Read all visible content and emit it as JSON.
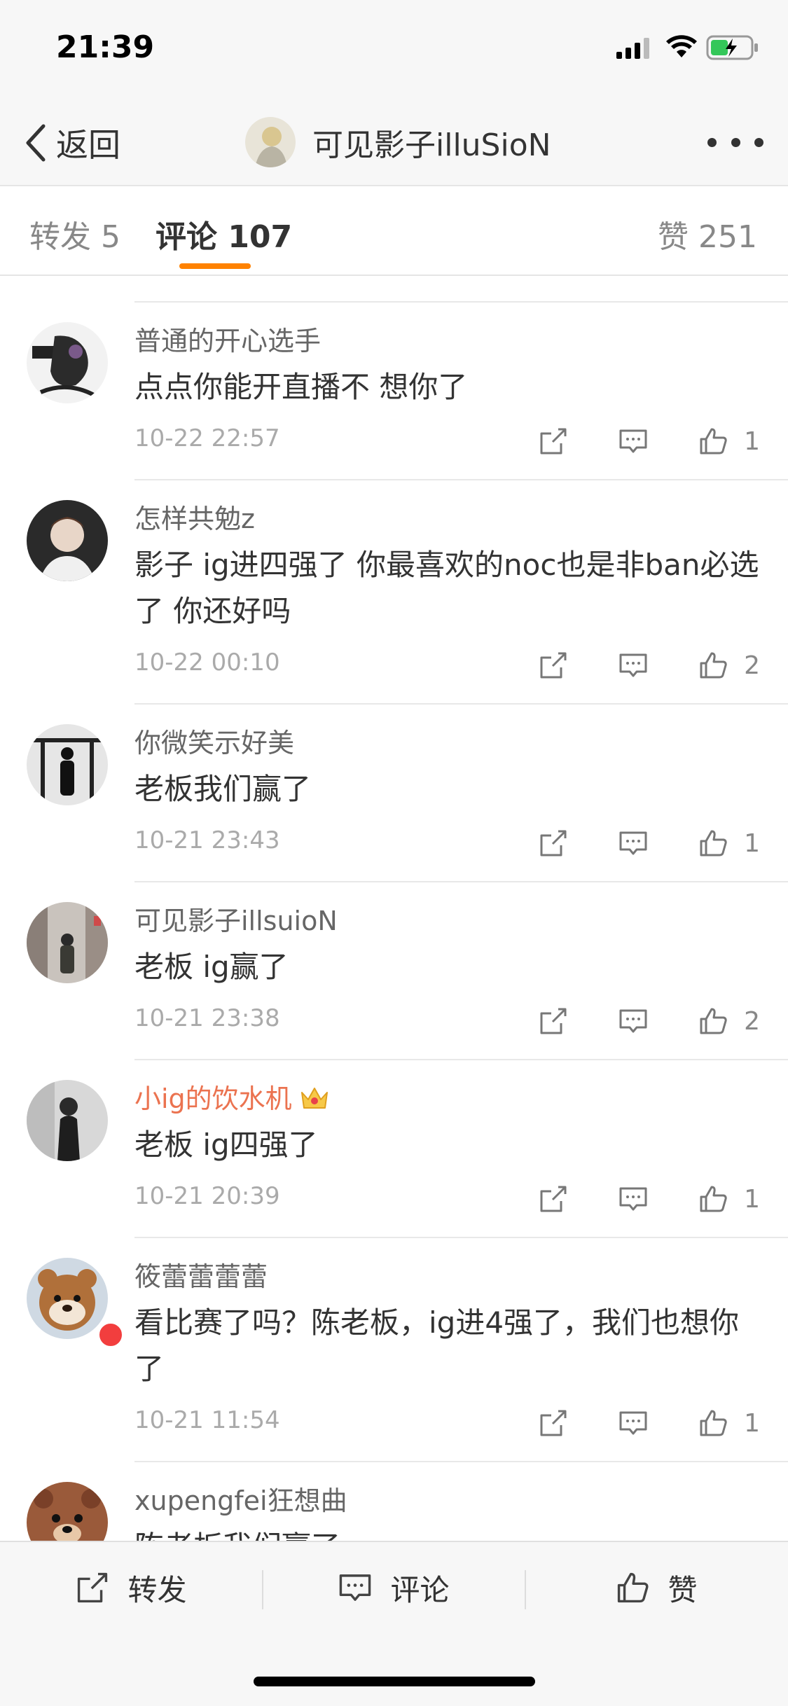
{
  "status_bar": {
    "time": "21:39"
  },
  "nav": {
    "back_label": "返回",
    "title": "可见影子illuSioN"
  },
  "tabs": {
    "repost": "转发 5",
    "comments": "评论 107",
    "likes": "赞 251"
  },
  "comments": [
    {
      "username": "普通的开心选手",
      "content": "点点你能开直播不 想你了",
      "time": "10-22 22:57",
      "likes": "1"
    },
    {
      "username": "怎样共勉z",
      "content": "影子 ig进四强了 你最喜欢的noc也是非ban必选了 你还好吗",
      "time": "10-22 00:10",
      "likes": "2"
    },
    {
      "username": "你微笑示好美",
      "content": "老板我们赢了",
      "time": "10-21 23:43",
      "likes": "1"
    },
    {
      "username": "可见影子illsuioN",
      "content": "老板 ig赢了",
      "time": "10-21 23:38",
      "likes": "2"
    },
    {
      "username": "小ig的饮水机",
      "content": "老板 ig四强了",
      "time": "10-21 20:39",
      "likes": "1"
    },
    {
      "username": "筱蕾蕾蕾蕾",
      "content": "看比赛了吗？陈老板，ig进4强了，我们也想你了",
      "time": "10-21 11:54",
      "likes": "1"
    },
    {
      "username": "xupengfei狂想曲",
      "content": "陈老板我们赢了"
    }
  ],
  "toolbar": {
    "repost_label": "转发",
    "comment_label": "评论",
    "like_label": "赞"
  },
  "colors": {
    "accent": "#ff8200",
    "vip_name": "#eb7350"
  }
}
